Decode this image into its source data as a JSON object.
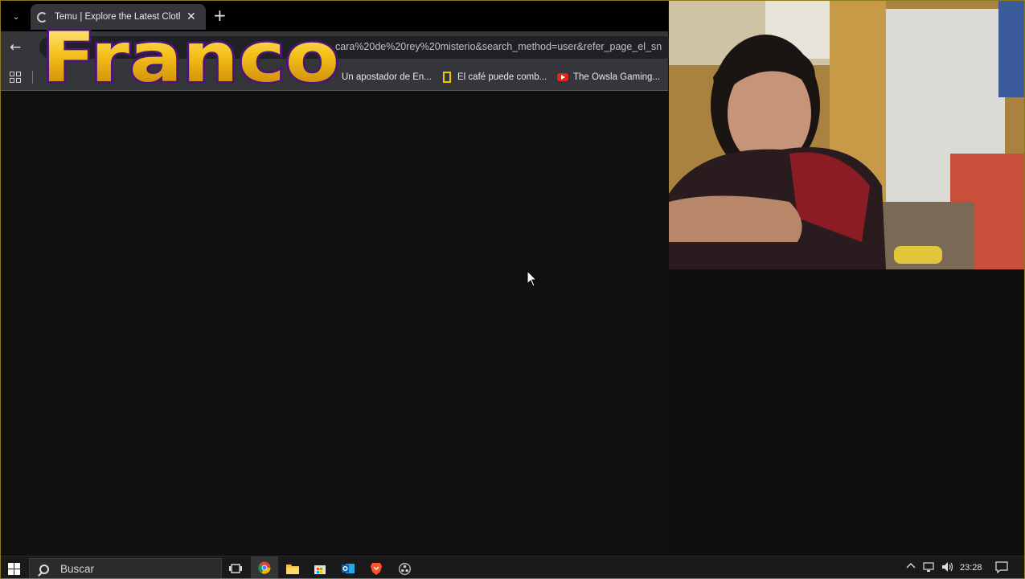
{
  "browser": {
    "tab": {
      "title": "Temu | Explore the Latest Clothi",
      "close_glyph": "✕"
    },
    "new_tab_glyph": "+",
    "back_glyph": "←",
    "tab_search_glyph": "⌄",
    "address_bar": {
      "url_visible": "cara%20de%20rey%20misterio&search_method=user&refer_page_el_sn"
    },
    "bookmarks": [
      {
        "label": "Un apostador de En...",
        "icon": "none"
      },
      {
        "label": "El café puede comb...",
        "icon": "natgeo-icon"
      },
      {
        "label": "The Owsla Gaming...",
        "icon": "youtube-icon"
      }
    ]
  },
  "overlay": {
    "logo_text": "Franco"
  },
  "taskbar": {
    "search_placeholder": "Buscar",
    "clock": "23:28",
    "tray_chevron": "^",
    "apps": [
      "task-view-icon",
      "chrome-icon",
      "file-explorer-icon",
      "store-icon",
      "outlook-icon",
      "brave-icon",
      "obs-icon"
    ]
  },
  "colors": {
    "tab_active": "#35363a",
    "page_bg": "#101010",
    "taskbar_bg": "#1a1a1a",
    "logo_gold": "#f5c21b",
    "logo_outline": "#5a1a8a"
  }
}
